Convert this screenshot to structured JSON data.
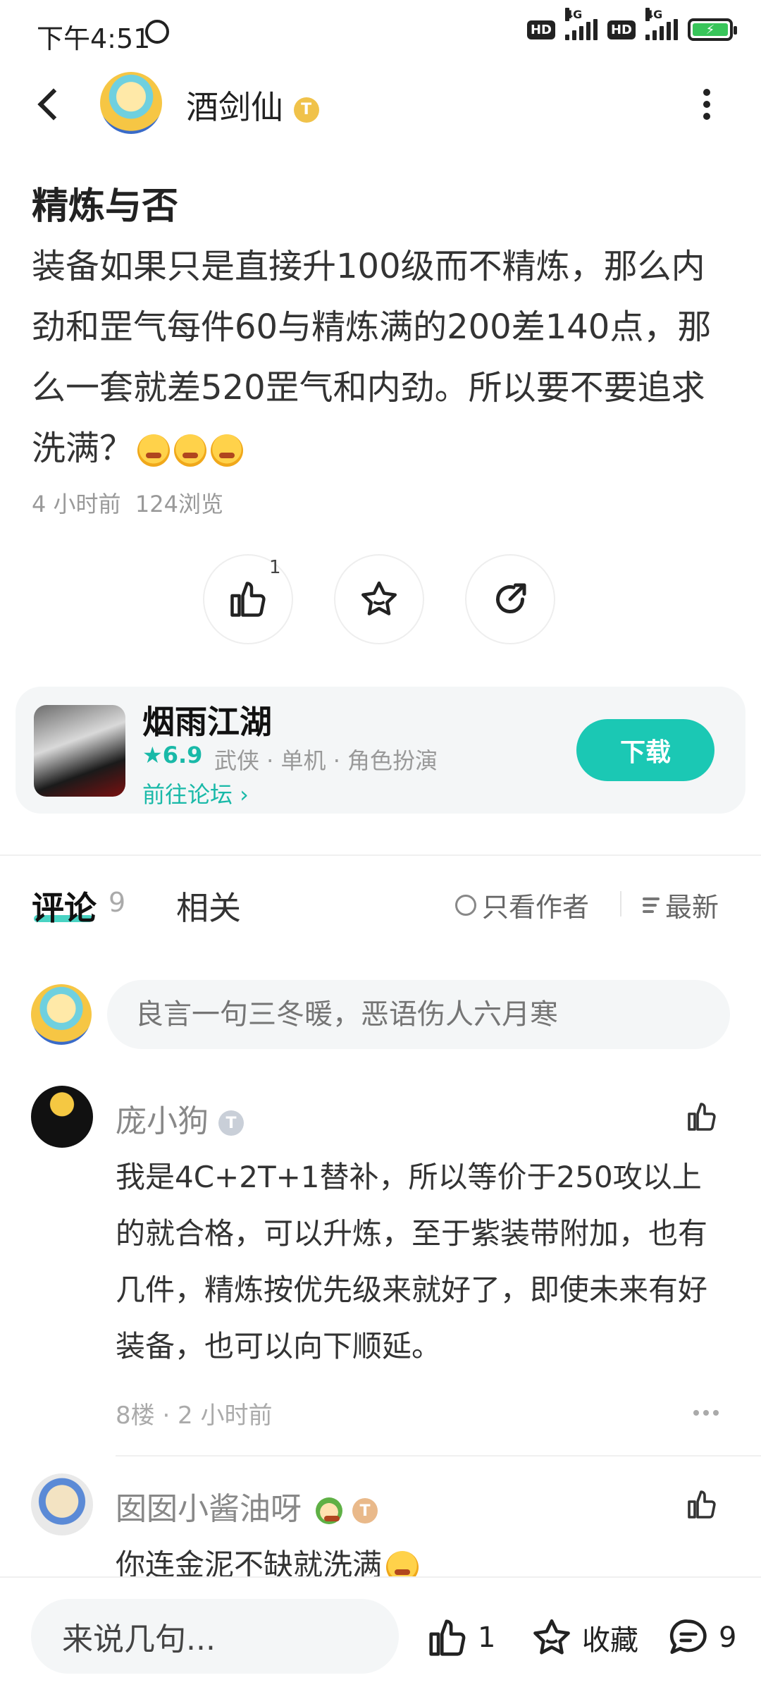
{
  "status_bar": {
    "time": "下午4:51",
    "hd1": "HD",
    "net1": "4G",
    "hd2": "HD",
    "net2": "4G"
  },
  "header": {
    "author_name": "酒剑仙",
    "author_badge": "T"
  },
  "post": {
    "title": "精炼与否",
    "body": "装备如果只是直接升100级而不精炼，那么内劲和罡气每件60与精炼满的200差140点，那么一套就差520罡气和内劲。所以要不要追求洗满？",
    "time": "4 小时前",
    "views": "124浏览",
    "like_count": "1"
  },
  "game_card": {
    "name": "烟雨江湖",
    "rating": "★6.9",
    "tags": "武侠 · 单机 · 角色扮演",
    "forum_link": "前往论坛 ›",
    "download_label": "下载",
    "accent_color": "#1bc8b4"
  },
  "tabs": {
    "comment_label": "评论",
    "comment_count": "9",
    "related_label": "相关",
    "only_author": "只看作者",
    "sort_label": "最新"
  },
  "comment_input": {
    "placeholder": "良言一句三冬暖，恶语伤人六月寒"
  },
  "comments": [
    {
      "name": "庞小狗",
      "badge": "T",
      "text": "我是4C+2T+1替补，所以等价于250攻以上的就合格，可以升炼，至于紫装带附加，也有几件，精炼按优先级来就好了，即使未来有好装备，也可以向下顺延。",
      "meta": "8楼 · 2 小时前"
    },
    {
      "name": "囡囡小酱油呀",
      "badge": "T",
      "text": "你连金泥不缺就洗满"
    }
  ],
  "bottom_bar": {
    "input_placeholder": "来说几句...",
    "like_count": "1",
    "favorite_label": "收藏",
    "comment_count": "9"
  }
}
